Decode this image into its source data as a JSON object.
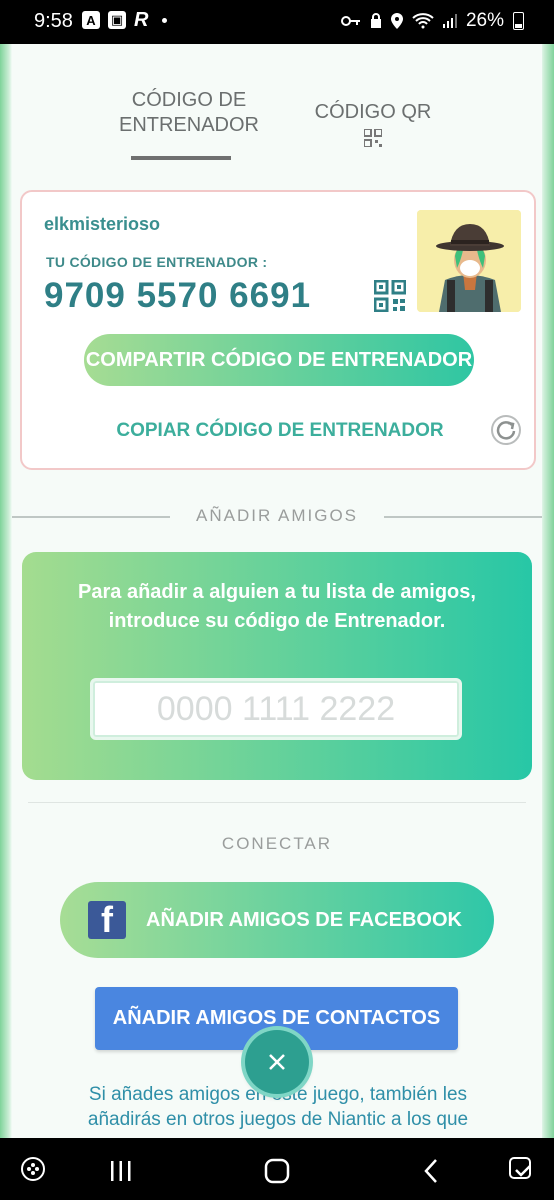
{
  "status_bar": {
    "time": "9:58",
    "battery": "26%"
  },
  "tabs": {
    "trainer_code": "CÓDIGO DE ENTRENADOR",
    "qr_code": "CÓDIGO QR"
  },
  "card": {
    "username": "elkmisterioso",
    "code_label": "TU CÓDIGO DE ENTRENADOR :",
    "code_value": "9709 5570 6691",
    "share_label": "COMPARTIR CÓDIGO DE ENTRENADOR",
    "copy_label": "COPIAR CÓDIGO DE ENTRENADOR"
  },
  "add_friends": {
    "section_title": "AÑADIR AMIGOS",
    "instructions": "Para añadir a alguien a tu lista de amigos, introduce su código de Entrenador.",
    "input_placeholder": "0000 1111 2222"
  },
  "connect": {
    "section_title": "CONECTAR",
    "facebook_label": "AÑADIR AMIGOS DE FACEBOOK",
    "contacts_label": "AÑADIR AMIGOS DE CONTACTOS",
    "note": "Si añades amigos en este juego, también les añadirás en otros juegos de Niantic a los que"
  },
  "colors": {
    "accent_green": "#2fc6a3",
    "teal_text": "#2f7f86",
    "contacts_blue": "#4a86e0",
    "facebook_blue": "#3b5998"
  }
}
